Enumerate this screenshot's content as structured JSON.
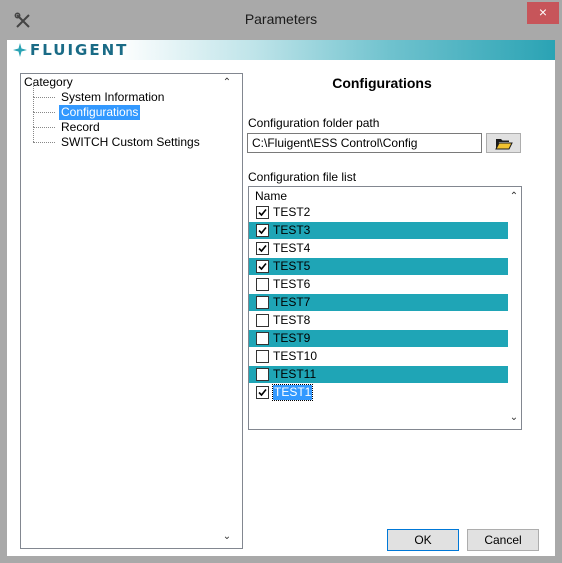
{
  "window": {
    "title": "Parameters",
    "close_label": "×"
  },
  "brand": {
    "name": "FLUIGENT",
    "color": "#1a6b86"
  },
  "tree": {
    "header": "Category",
    "items": [
      {
        "label": "System Information",
        "selected": false
      },
      {
        "label": "Configurations",
        "selected": true
      },
      {
        "label": "Record",
        "selected": false
      },
      {
        "label": "SWITCH Custom Settings",
        "selected": false
      }
    ]
  },
  "main": {
    "title": "Configurations",
    "folder_label": "Configuration folder path",
    "folder_value": "C:\\Fluigent\\ESS Control\\Config",
    "list_label": "Configuration file list",
    "list_header": "Name",
    "files": [
      {
        "name": "TEST2",
        "checked": true,
        "highlight": false
      },
      {
        "name": "TEST3",
        "checked": true,
        "highlight": true
      },
      {
        "name": "TEST4",
        "checked": true,
        "highlight": false
      },
      {
        "name": "TEST5",
        "checked": true,
        "highlight": true
      },
      {
        "name": "TEST6",
        "checked": false,
        "highlight": false
      },
      {
        "name": "TEST7",
        "checked": false,
        "highlight": true
      },
      {
        "name": "TEST8",
        "checked": false,
        "highlight": false
      },
      {
        "name": "TEST9",
        "checked": false,
        "highlight": true
      },
      {
        "name": "TEST10",
        "checked": false,
        "highlight": false
      },
      {
        "name": "TEST11",
        "checked": false,
        "highlight": true
      },
      {
        "name": "TEST1",
        "checked": true,
        "highlight": false,
        "focused": true
      }
    ],
    "highlight_color": "#1fa5b6"
  },
  "buttons": {
    "ok": "OK",
    "cancel": "Cancel"
  }
}
